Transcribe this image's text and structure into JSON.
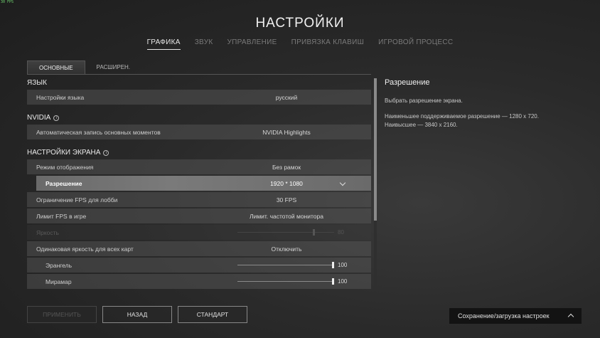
{
  "fps_counter": "30 FPS",
  "title": "НАСТРОЙКИ",
  "tabs": [
    {
      "label": "ГРАФИКА",
      "active": true
    },
    {
      "label": "ЗВУК",
      "active": false
    },
    {
      "label": "УПРАВЛЕНИЕ",
      "active": false
    },
    {
      "label": "ПРИВЯЗКА КЛАВИШ",
      "active": false
    },
    {
      "label": "ИГРОВОЙ ПРОЦЕСС",
      "active": false
    }
  ],
  "subtabs": [
    {
      "label": "ОСНОВНЫЕ",
      "active": true
    },
    {
      "label": "РАСШИРЕН.",
      "active": false
    }
  ],
  "sections": {
    "language": {
      "title": "ЯЗЫК",
      "row_label": "Настройки языка",
      "row_value": "русский"
    },
    "nvidia": {
      "title": "NVIDIA",
      "row_label": "Автоматическая запись основных моментов",
      "row_value": "NVIDIA Highlights"
    },
    "screen": {
      "title": "НАСТРОЙКИ ЭКРАНА",
      "display_mode_label": "Режим отображения",
      "display_mode_value": "Без рамок",
      "resolution_label": "Разрешение",
      "resolution_value": "1920 * 1080",
      "lobby_fps_label": "Ограничение FPS для лобби",
      "lobby_fps_value": "30 FPS",
      "ingame_fps_label": "Лимит FPS в игре",
      "ingame_fps_value": "Лимит. частотой монитора",
      "brightness_label": "Яркость",
      "brightness_value": "80",
      "brightness_level": 0.8,
      "same_brightness_label": "Одинаковая яркость для всех карт",
      "same_brightness_value": "Отключить",
      "erangel_label": "Эрангель",
      "erangel_value": "100",
      "erangel_level": 1.0,
      "miramar_label": "Мирамар",
      "miramar_value": "100",
      "miramar_level": 1.0
    }
  },
  "description": {
    "heading": "Разрешение",
    "line1": "Выбрать разрешение экрана.",
    "line2": "Наименьшее поддерживаемое разрешение — 1280 x 720.",
    "line3": "Наивысшее — 3840 x 2160."
  },
  "buttons": {
    "apply": "ПРИМЕНИТЬ",
    "back": "НАЗАД",
    "default": "СТАНДАРТ"
  },
  "saveload_label": "Сохранение/загрузка настроек"
}
